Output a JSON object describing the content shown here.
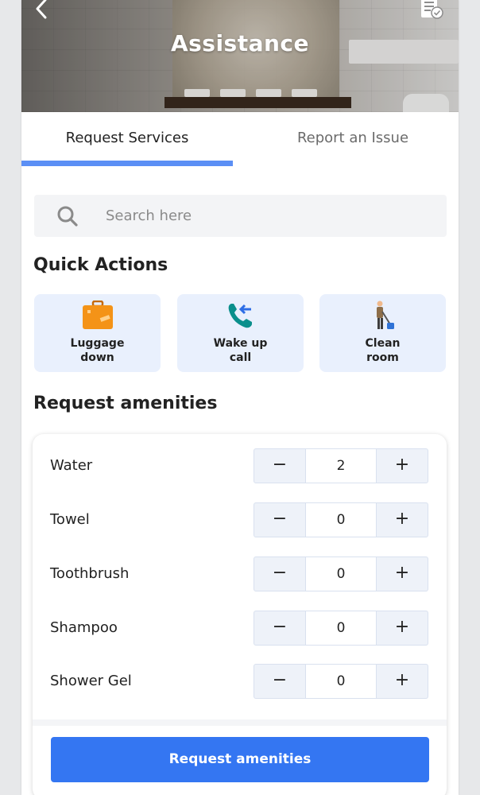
{
  "header": {
    "title": "Assistance",
    "back_icon": "chevron-left-icon",
    "action_icon": "document-check-icon"
  },
  "tabs": [
    {
      "label": "Request Services",
      "active": true
    },
    {
      "label": "Report an Issue",
      "active": false
    }
  ],
  "search": {
    "placeholder": "Search here",
    "value": ""
  },
  "quick_actions": {
    "title": "Quick Actions",
    "items": [
      {
        "line1": "Luggage",
        "line2": "down",
        "icon": "luggage-icon"
      },
      {
        "line1": "Wake up",
        "line2": "call",
        "icon": "phone-call-icon"
      },
      {
        "line1": "Clean",
        "line2": "room",
        "icon": "cleaning-person-icon"
      }
    ]
  },
  "amenities": {
    "title": "Request amenities",
    "items": [
      {
        "name": "Water",
        "quantity": "2"
      },
      {
        "name": "Towel",
        "quantity": "0"
      },
      {
        "name": "Toothbrush",
        "quantity": "0"
      },
      {
        "name": "Shampoo",
        "quantity": "0"
      },
      {
        "name": "Shower Gel",
        "quantity": "0"
      }
    ],
    "minus_label": "−",
    "plus_label": "+",
    "submit_label": "Request amenities"
  },
  "colors": {
    "accent": "#3476f2",
    "tab_indicator": "#5b8ff5",
    "card_bg": "#e9f0fd"
  }
}
